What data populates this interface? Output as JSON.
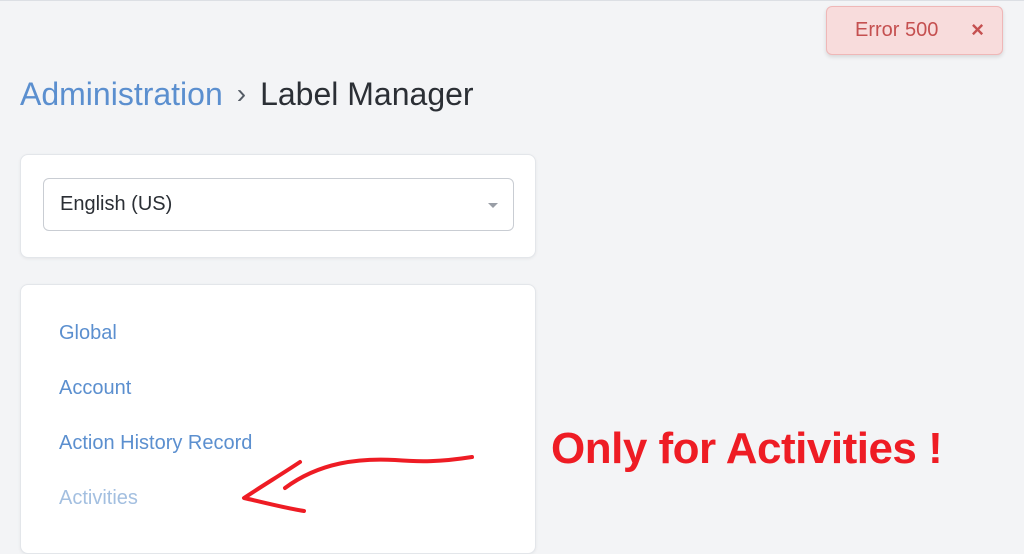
{
  "toast": {
    "message": "Error 500",
    "close_icon": "×",
    "color": "#c55050"
  },
  "breadcrumb": {
    "parent": "Administration",
    "separator": "›",
    "current": "Label Manager"
  },
  "language_select": {
    "value": "English (US)"
  },
  "categories": [
    {
      "label": "Global"
    },
    {
      "label": "Account"
    },
    {
      "label": "Action History Record"
    },
    {
      "label": "Activities"
    }
  ],
  "annotation": {
    "text": "Only for Activities !",
    "color": "#ee1c24"
  }
}
